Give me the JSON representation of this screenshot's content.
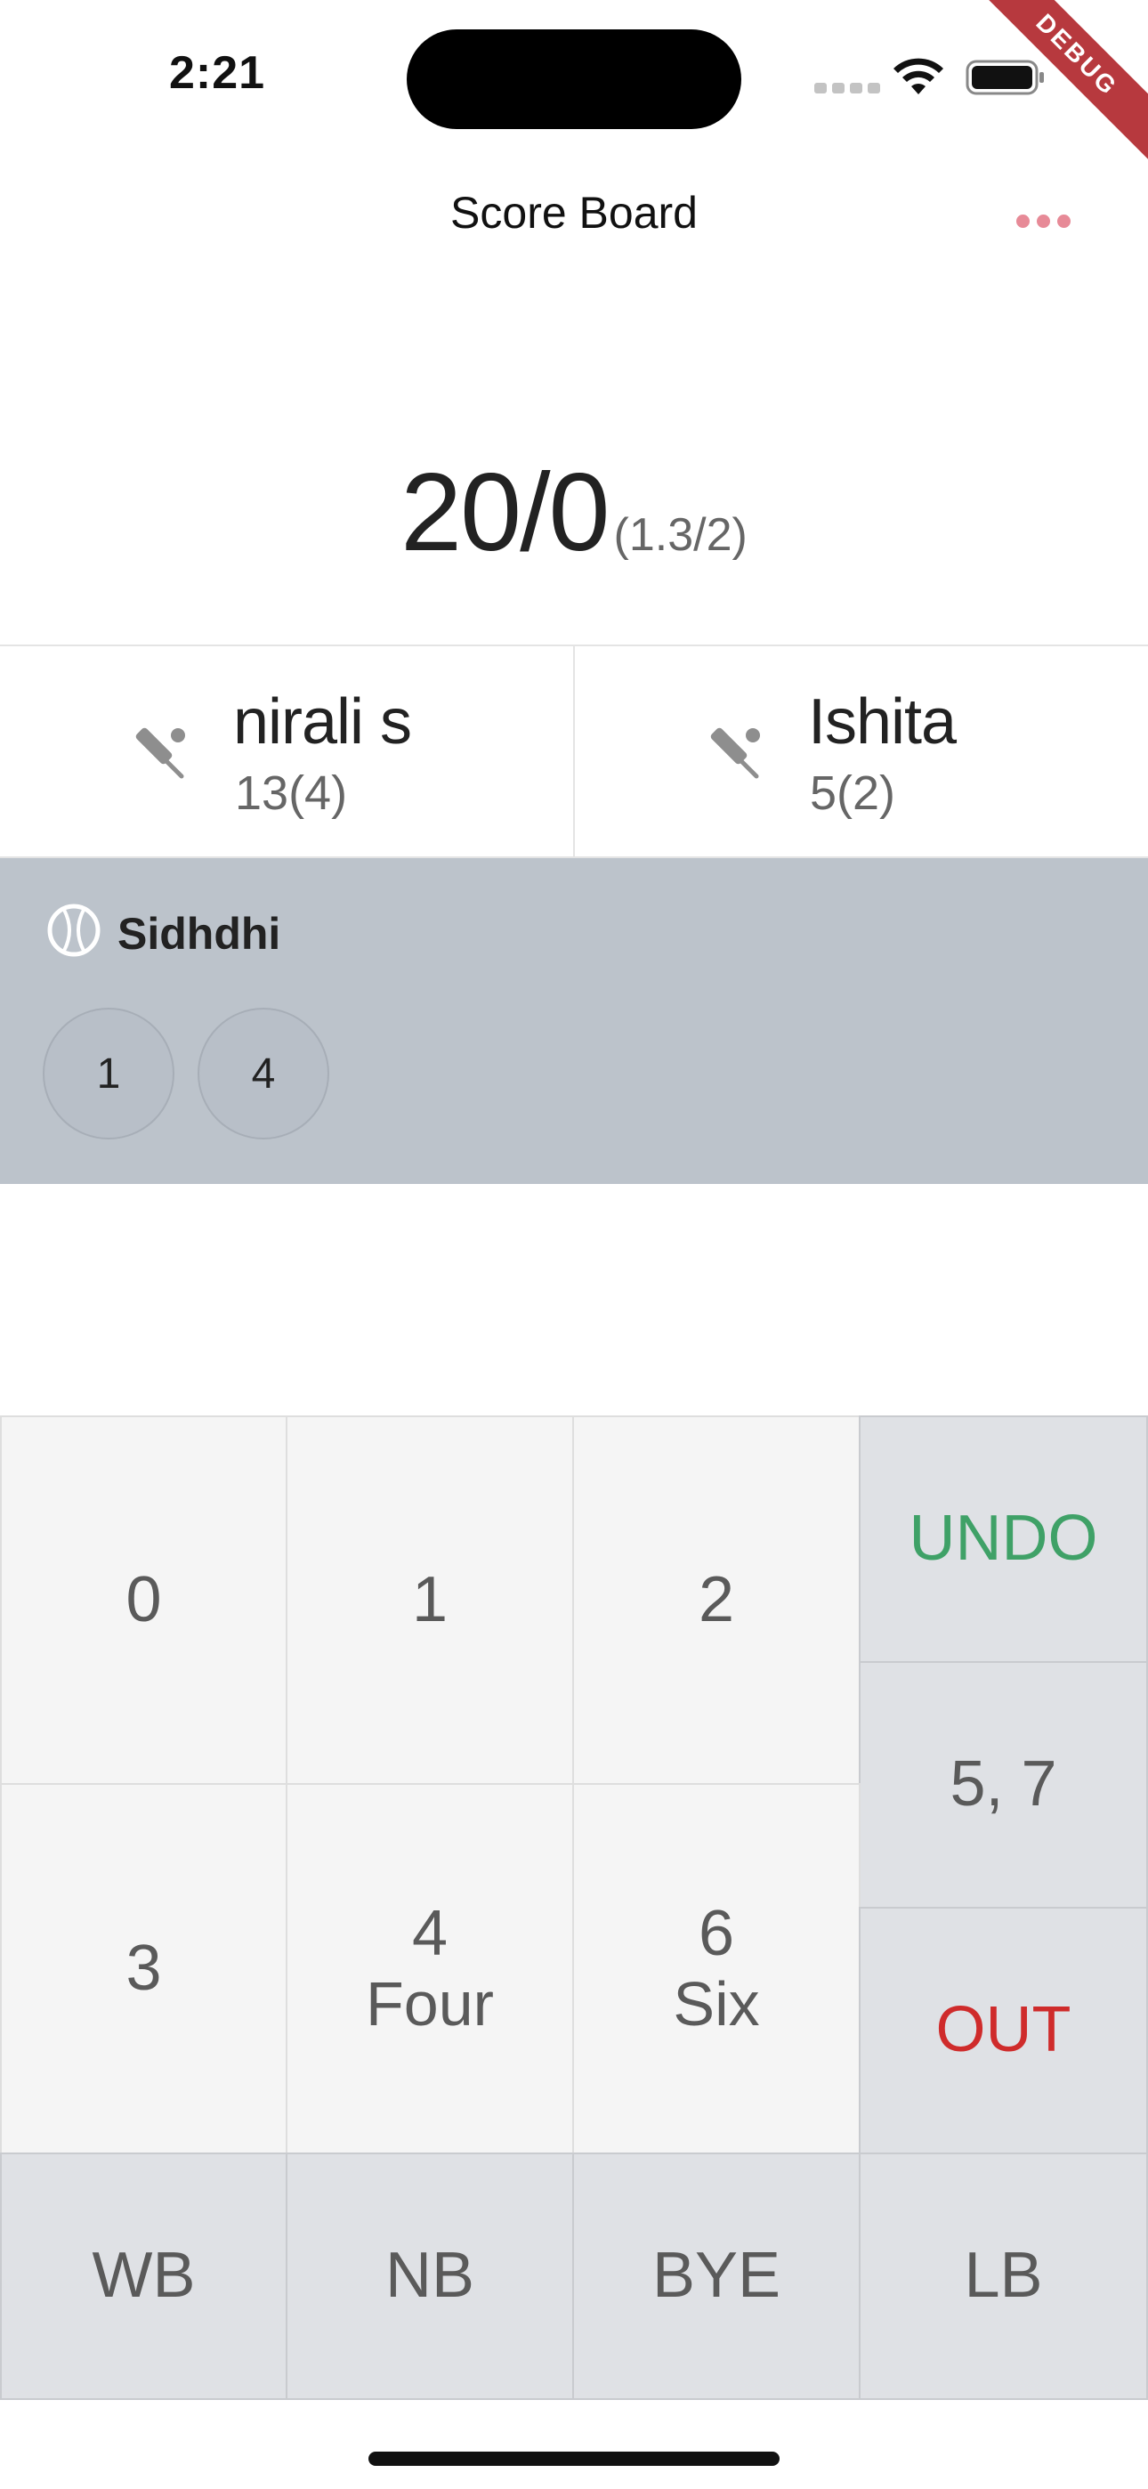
{
  "status_bar": {
    "time": "2:21",
    "debug_label": "DEBUG",
    "icons": [
      "signal-icon",
      "wifi-icon",
      "battery-icon"
    ]
  },
  "nav": {
    "title": "Score Board",
    "more_icon": "more-horizontal-icon",
    "accent_color": "#e78a97"
  },
  "score": {
    "runs_wickets": "20/0",
    "overs": "(1.3/2)"
  },
  "batsmen": [
    {
      "name": "nirali s",
      "score": "13(4)",
      "icon": "cricket-bat-icon"
    },
    {
      "name": "Ishita",
      "score": "5(2)",
      "icon": "cricket-bat-icon"
    }
  ],
  "bowler": {
    "name": "Sidhdhi",
    "icon": "cricket-ball-icon",
    "balls": [
      "1",
      "4"
    ]
  },
  "keypad": {
    "k0": "0",
    "k1": "1",
    "k2": "2",
    "k3": "3",
    "k4_main": "4",
    "k4_sub": "Four",
    "k6_main": "6",
    "k6_sub": "Six",
    "undo": "UNDO",
    "five_seven": "5, 7",
    "out": "OUT",
    "wb": "WB",
    "nb": "NB",
    "bye": "BYE",
    "lb": "LB",
    "colors": {
      "undo": "#3fa167",
      "out": "#cf2b2b"
    }
  }
}
